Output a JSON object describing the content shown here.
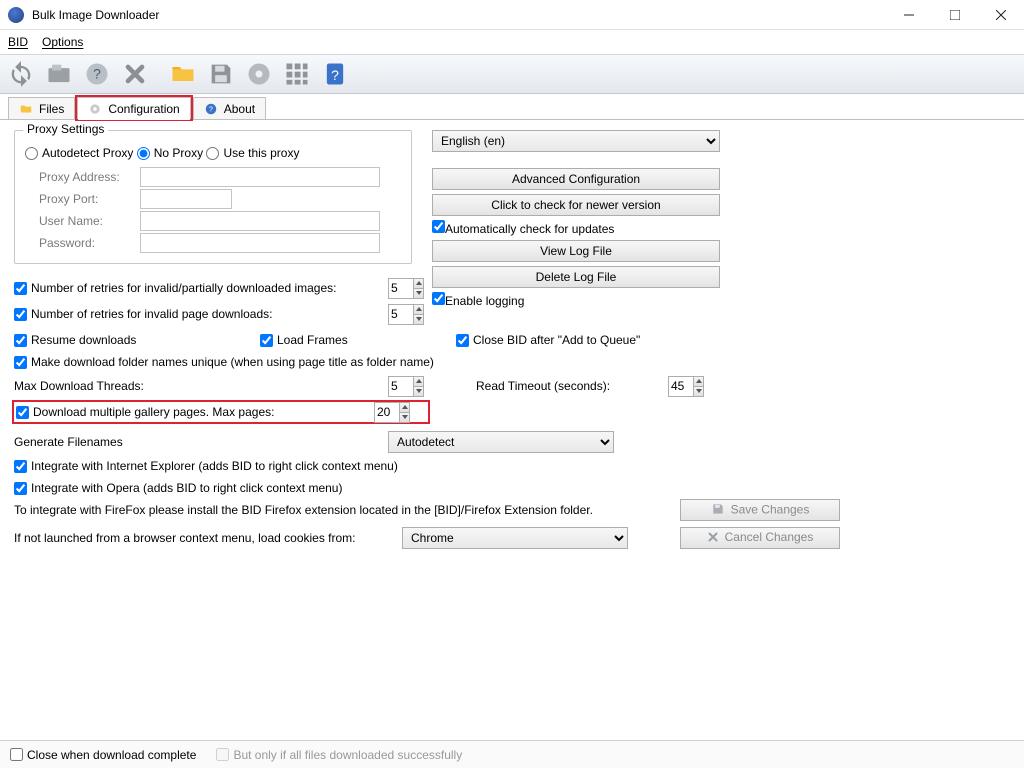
{
  "window": {
    "title": "Bulk Image Downloader"
  },
  "menu": {
    "bid": "BID",
    "options": "Options"
  },
  "tabs": {
    "files": "Files",
    "configuration": "Configuration",
    "about": "About"
  },
  "proxy": {
    "legend": "Proxy Settings",
    "autodetect": "Autodetect Proxy",
    "noproxy": "No Proxy",
    "usethis": "Use this proxy",
    "addr_label": "Proxy Address:",
    "port_label": "Proxy Port:",
    "user_label": "User Name:",
    "pass_label": "Password:"
  },
  "right": {
    "language": "English (en)",
    "advanced": "Advanced Configuration",
    "checknew": "Click to check for newer version",
    "autocheck": "Automatically check for updates",
    "viewlog": "View Log File",
    "dellog": "Delete Log File",
    "enablelog": "Enable logging"
  },
  "mid": {
    "retries_img": "Number of retries for invalid/partially downloaded images:",
    "retries_page": "Number of retries for invalid page downloads:",
    "retries_img_val": "5",
    "retries_page_val": "5",
    "resume": "Resume downloads",
    "loadframes": "Load Frames",
    "closebid": "Close BID after \"Add to Queue\"",
    "unique": "Make download folder names unique (when using page title as folder name)",
    "maxthreads_label": "Max Download Threads:",
    "maxthreads_val": "5",
    "readto_label": "Read Timeout (seconds):",
    "readto_val": "45",
    "multigallery": "Download multiple gallery pages. Max pages:",
    "multigallery_val": "20",
    "genfiles_label": "Generate Filenames",
    "genfiles_val": "Autodetect",
    "ie": "Integrate with Internet Explorer (adds BID to right click context menu)",
    "opera": "Integrate with Opera (adds BID to right click context menu)",
    "firefox": "To integrate with FireFox please install the BID Firefox extension located in the [BID]/Firefox Extension folder.",
    "cookies_label": "If not launched from a browser context menu, load cookies from:",
    "cookies_val": "Chrome",
    "save": "Save Changes",
    "cancel": "Cancel Changes"
  },
  "status": {
    "closewhen": "Close when download complete",
    "butonly": "But only if all files downloaded successfully"
  }
}
